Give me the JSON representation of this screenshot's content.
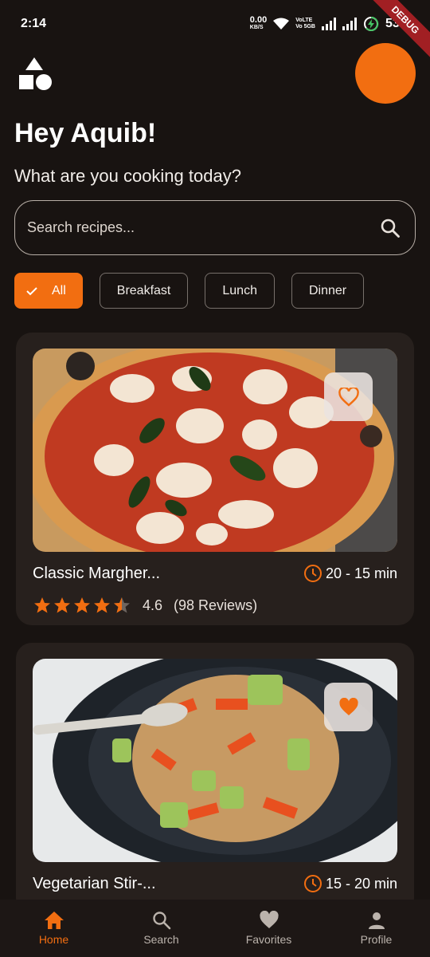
{
  "status_bar": {
    "time": "2:14",
    "net_speed": "0.00",
    "net_unit": "KB/S",
    "volte_1": "VoLTE",
    "volte_2": "Vo 5GB",
    "battery": "53%",
    "debug_banner": "DEBUG"
  },
  "header": {
    "logo_icon": "shapes-icon",
    "greeting": "Hey Aquib!",
    "subtitle": "What are you cooking today?"
  },
  "search": {
    "placeholder": "Search recipes..."
  },
  "filters": [
    {
      "label": "All",
      "selected": true
    },
    {
      "label": "Breakfast",
      "selected": false
    },
    {
      "label": "Lunch",
      "selected": false
    },
    {
      "label": "Dinner",
      "selected": false
    }
  ],
  "recipes": [
    {
      "title": "Classic Margher...",
      "time": "20 - 15 min",
      "rating": "4.6",
      "reviews": "(98 Reviews)",
      "stars": 4.6,
      "favorite": false
    },
    {
      "title": "Vegetarian Stir-...",
      "time": "15 - 20 min",
      "favorite": true
    }
  ],
  "nav": [
    {
      "label": "Home",
      "icon": "home-icon",
      "active": true
    },
    {
      "label": "Search",
      "icon": "search-icon",
      "active": false
    },
    {
      "label": "Favorites",
      "icon": "heart-icon",
      "active": false
    },
    {
      "label": "Profile",
      "icon": "person-icon",
      "active": false
    }
  ],
  "colors": {
    "accent": "#f26e11",
    "background": "#181311",
    "card": "#27201d"
  }
}
